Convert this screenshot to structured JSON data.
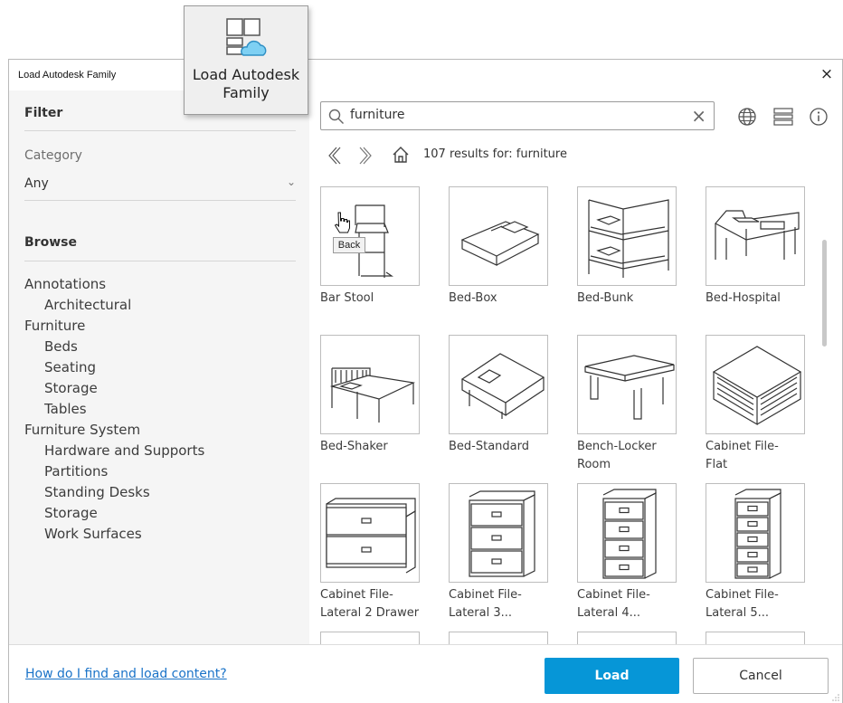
{
  "ribbon_tooltip": {
    "line1": "Load Autodesk",
    "line2": "Family",
    "icon": "load-autodesk-family-icon"
  },
  "dialog": {
    "title": "Load Autodesk Family",
    "close_glyph": "×"
  },
  "sidebar": {
    "filter_heading": "Filter",
    "category_label": "Category",
    "category_value": "Any",
    "browse_heading": "Browse",
    "tree": [
      {
        "label": "Annotations",
        "level": 0
      },
      {
        "label": "Architectural",
        "level": 1
      },
      {
        "label": "Furniture",
        "level": 0
      },
      {
        "label": "Beds",
        "level": 1
      },
      {
        "label": "Seating",
        "level": 1
      },
      {
        "label": "Storage",
        "level": 1
      },
      {
        "label": "Tables",
        "level": 1
      },
      {
        "label": "Furniture System",
        "level": 0
      },
      {
        "label": "Hardware and Supports",
        "level": 1
      },
      {
        "label": "Partitions",
        "level": 1
      },
      {
        "label": "Standing Desks",
        "level": 1
      },
      {
        "label": "Storage",
        "level": 1
      },
      {
        "label": "Work Surfaces",
        "level": 1
      }
    ]
  },
  "search": {
    "value": "furniture",
    "clear_glyph": "×"
  },
  "toolbar_icons": [
    "globe-icon",
    "list-view-icon",
    "info-icon"
  ],
  "nav": {
    "count_text": "107 results for: furniture",
    "back_tooltip": "Back"
  },
  "results": [
    {
      "label": "Bar Stool",
      "kind": "stool"
    },
    {
      "label": "Bed-Box",
      "kind": "bed-box"
    },
    {
      "label": "Bed-Bunk",
      "kind": "bunk"
    },
    {
      "label": "Bed-Hospital",
      "kind": "hospital"
    },
    {
      "label": "Bed-Shaker",
      "kind": "shaker"
    },
    {
      "label": "Bed-Standard",
      "kind": "bed-standard"
    },
    {
      "label": "Bench-Locker\nRoom",
      "kind": "bench"
    },
    {
      "label": "Cabinet File-\nFlat",
      "kind": "flat-file"
    },
    {
      "label": "Cabinet File-\nLateral 2 Drawer",
      "kind": "lateral2"
    },
    {
      "label": "Cabinet File-\nLateral 3...",
      "kind": "lateral3"
    },
    {
      "label": "Cabinet File-\nLateral 4...",
      "kind": "lateral4"
    },
    {
      "label": "Cabinet File-\nLateral 5...",
      "kind": "lateral5"
    },
    {
      "label": "",
      "kind": "partial"
    },
    {
      "label": "",
      "kind": "partial"
    },
    {
      "label": "",
      "kind": "partial"
    },
    {
      "label": "",
      "kind": "partial"
    }
  ],
  "footer": {
    "help_link": "How do I find and load content?",
    "load_label": "Load",
    "cancel_label": "Cancel"
  },
  "colors": {
    "primary": "#0696d7",
    "link": "#1a73c8",
    "sidebar_bg": "#f5f5f5"
  }
}
